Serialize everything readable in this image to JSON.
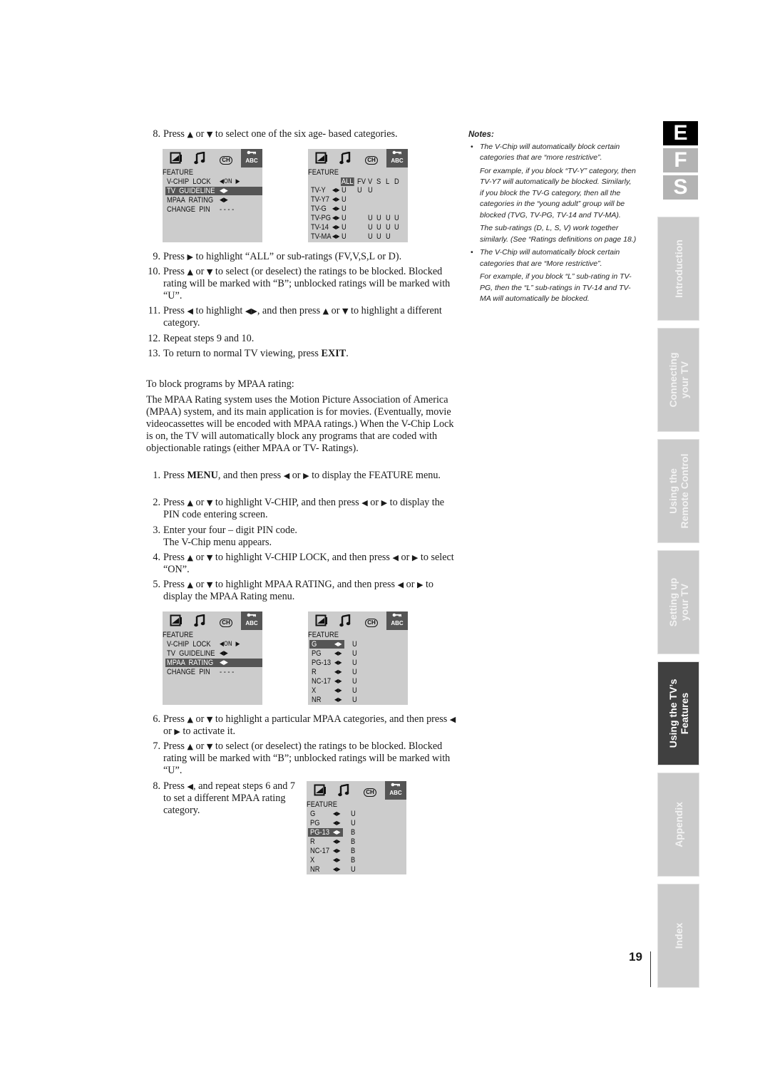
{
  "steps_top": [
    {
      "num": "8.",
      "text_parts": [
        "Press ",
        "▲",
        " or ",
        "▼",
        " to select one of the six age- based categories."
      ]
    },
    {
      "num": "9.",
      "text_parts": [
        "Press ",
        "▶",
        " to highlight “ALL” or sub-ratings (FV,V,S,L or D)."
      ]
    },
    {
      "num": "10.",
      "text_parts": [
        "Press ",
        "▲",
        " or ",
        "▼",
        " to select (or deselect) the ratings to be blocked. Blocked rating will be marked with “B”; unblocked ratings will be marked with “U”."
      ]
    },
    {
      "num": "11.",
      "text_parts": [
        "Press ",
        "◀",
        " to highlight ",
        "◀▶",
        ", and then press ",
        "▲",
        " or ",
        "▼",
        " to highlight a different category."
      ]
    },
    {
      "num": "12.",
      "text_parts": [
        "Repeat steps 9 and 10."
      ]
    },
    {
      "num": "13.",
      "text_parts": [
        "To return to normal TV viewing, press ",
        "EXIT",
        "."
      ]
    }
  ],
  "mpaa_intro": "To block programs by MPAA rating:",
  "mpaa_description": "The MPAA Rating system uses the Motion Picture Association of America (MPAA) system, and its main application is for movies. (Eventually, movie videocassettes will be encoded with MPAA ratings.) When the V-Chip Lock is on, the TV will automatically  block any programs that are coded with objectionable ratings (either MPAA or TV- Ratings).",
  "steps_mpaa": [
    {
      "num": "1.",
      "text_parts": [
        "Press ",
        "MENU",
        ", and then press ",
        "◀",
        " or ",
        "▶",
        " to display the FEATURE menu."
      ]
    },
    {
      "num": "2.",
      "text_parts": [
        "Press ",
        "▲",
        " or ",
        "▼",
        " to highlight V-CHIP, and then press ",
        "◀",
        " or ",
        "▶",
        " to display the PIN code entering screen."
      ]
    },
    {
      "num": "3.",
      "text_parts": [
        "Enter your four – digit PIN code.",
        "The V-Chip menu appears."
      ]
    },
    {
      "num": "4.",
      "text_parts": [
        "Press ",
        "▲",
        " or ",
        "▼",
        " to highlight V-CHIP LOCK, and then press ",
        "◀",
        " or ",
        "▶",
        " to select “ON”."
      ]
    },
    {
      "num": "5.",
      "text_parts": [
        "Press ",
        "▲",
        " or ",
        "▼",
        " to highlight MPAA RATING, and then press ",
        "◀",
        " or ",
        "▶",
        " to display the MPAA Rating menu."
      ]
    },
    {
      "num": "6.",
      "text_parts": [
        "Press ",
        "▲",
        " or ",
        "▼",
        " to highlight a particular MPAA categories, and then press ",
        "◀",
        " or ",
        "▶",
        " to activate it."
      ]
    },
    {
      "num": "7.",
      "text_parts": [
        "Press ",
        "▲",
        " or ",
        "▼",
        " to select (or deselect) the ratings to be blocked. Blocked rating will be marked with “B”; unblocked ratings will be marked with “U”."
      ]
    },
    {
      "num": "8.",
      "text_parts": [
        "Press ",
        "◀",
        ", and repeat steps 6 and 7 to set a different MPAA rating category."
      ]
    }
  ],
  "menu_icons": {
    "picture": "picture-icon",
    "audio": "music-note-icon",
    "channel": "CH",
    "lock": "ABC"
  },
  "menus": {
    "feature_tv": {
      "title": "FEATURE",
      "rows": [
        {
          "label": "V-CHIP  LOCK",
          "value": "◀ON  ▶",
          "highlight": false
        },
        {
          "label": "TV  GUIDELINE",
          "value": "◀▶",
          "highlight": true
        },
        {
          "label": "MPAA  RATING",
          "value": "◀▶",
          "highlight": false
        },
        {
          "label": "CHANGE  PIN",
          "value": "- - - -",
          "highlight": false
        }
      ]
    },
    "tv_ratings": {
      "title": "FEATURE",
      "columns": [
        "ALL",
        "FV",
        "V",
        "S",
        "L",
        "D"
      ],
      "rows": [
        {
          "label": "TV-Y",
          "arrow": "◀▶",
          "cells": [
            "U",
            "U",
            "U",
            "",
            "",
            ""
          ]
        },
        {
          "label": "TV-Y7",
          "arrow": "◀▶",
          "cells": [
            "U",
            "",
            "",
            "",
            "",
            ""
          ]
        },
        {
          "label": "TV-G",
          "arrow": "◀▶",
          "cells": [
            "U",
            "",
            "",
            "",
            "",
            ""
          ]
        },
        {
          "label": "TV-PG",
          "arrow": "◀▶",
          "cells": [
            "U",
            "",
            "U",
            "U",
            "U",
            "U"
          ]
        },
        {
          "label": "TV-14",
          "arrow": "◀▶",
          "cells": [
            "U",
            "",
            "U",
            "U",
            "U",
            "U"
          ]
        },
        {
          "label": "TV-MA",
          "arrow": "◀▶",
          "cells": [
            "U",
            "",
            "U",
            "U",
            "U",
            ""
          ]
        }
      ]
    },
    "feature_mpaa": {
      "title": "FEATURE",
      "rows": [
        {
          "label": "V-CHIP  LOCK",
          "value": "◀ON  ▶",
          "highlight": false
        },
        {
          "label": "TV  GUIDELINE",
          "value": "◀▶",
          "highlight": false
        },
        {
          "label": "MPAA  RATING",
          "value": "◀▶",
          "highlight": true
        },
        {
          "label": "CHANGE  PIN",
          "value": "- - - -",
          "highlight": false
        }
      ]
    },
    "mpaa_unblocked": {
      "title": "FEATURE",
      "rows": [
        {
          "label": "G",
          "arrow": "◀▶",
          "value": "U",
          "highlight": true
        },
        {
          "label": "PG",
          "arrow": "◀▶",
          "value": "U",
          "highlight": false
        },
        {
          "label": "PG-13",
          "arrow": "◀▶",
          "value": "U",
          "highlight": false
        },
        {
          "label": "R",
          "arrow": "◀▶",
          "value": "U",
          "highlight": false
        },
        {
          "label": "NC-17",
          "arrow": "◀▶",
          "value": "U",
          "highlight": false
        },
        {
          "label": "X",
          "arrow": "◀▶",
          "value": "U",
          "highlight": false
        },
        {
          "label": "NR",
          "arrow": "◀▶",
          "value": "U",
          "highlight": false
        }
      ]
    },
    "mpaa_blocked": {
      "title": "FEATURE",
      "rows": [
        {
          "label": "G",
          "arrow": "◀▶",
          "value": "U",
          "highlight": false
        },
        {
          "label": "PG",
          "arrow": "◀▶",
          "value": "U",
          "highlight": false
        },
        {
          "label": "PG-13",
          "arrow": "◀▶",
          "value": "B",
          "highlight": true
        },
        {
          "label": "R",
          "arrow": "◀▶",
          "value": "B",
          "highlight": false
        },
        {
          "label": "NC-17",
          "arrow": "◀▶",
          "value": "B",
          "highlight": false
        },
        {
          "label": "X",
          "arrow": "◀▶",
          "value": "B",
          "highlight": false
        },
        {
          "label": "NR",
          "arrow": "◀▶",
          "value": "U",
          "highlight": false
        }
      ]
    }
  },
  "notes": {
    "heading": "Notes:",
    "items": [
      {
        "bullet": "The V-Chip will automatically block certain categories that are “more restrictive”.",
        "subs": [
          "For example, if you block “TV-Y” category, then TV-Y7 will automatically be blocked. Similarly, if you block the TV-G category, then all the categories in the “young adult” group will be blocked (TVG, TV-PG, TV-14 and TV-MA).",
          "The sub-ratings (D, L, S, V) work together similarly. (See “Ratings definitions on page 18.)"
        ]
      },
      {
        "bullet": "The V-Chip will automatically block certain categories that are “More restrictive”.",
        "subs": [
          "For example, if you block “L” sub-rating in TV-PG, then the “L” sub-ratings in TV-14 and TV-MA will automatically be blocked."
        ]
      }
    ]
  },
  "language_tabs": [
    {
      "letter": "E",
      "active": true
    },
    {
      "letter": "F",
      "active": false
    },
    {
      "letter": "S",
      "active": false
    }
  ],
  "section_tabs": [
    {
      "line1": "Introduction",
      "line2": "",
      "active": false
    },
    {
      "line1": "Connecting",
      "line2": "your TV",
      "active": false
    },
    {
      "line1": "Using the",
      "line2": "Remote Control",
      "active": false
    },
    {
      "line1": "Setting up",
      "line2": "your TV",
      "active": false
    },
    {
      "line1": "Using the TV’s",
      "line2": "Features",
      "active": true
    },
    {
      "line1": "Appendix",
      "line2": "",
      "active": false
    },
    {
      "line1": "Index",
      "line2": "",
      "active": false
    }
  ],
  "page_number": "19",
  "colors": {
    "menu_bg": "#cccccc",
    "menu_highlight": "#555555",
    "tab_inactive": "#cbcbcb",
    "tab_active": "#404040",
    "lang_active": "#000000",
    "lang_inactive": "#b3b3b3"
  }
}
